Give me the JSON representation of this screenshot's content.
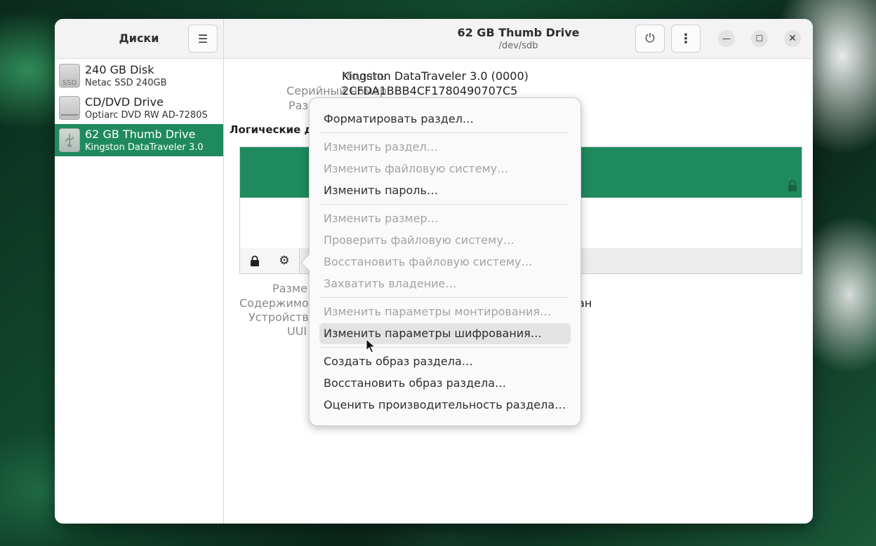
{
  "sidebar": {
    "title": "Диски",
    "drives": [
      {
        "name": "240 GB Disk",
        "model": "Netac SSD 240GB",
        "icon": "ssd-icon",
        "icon_text": "SSD"
      },
      {
        "name": "CD/DVD Drive",
        "model": "Optiarc DVD RW AD-7280S",
        "icon": "optical-drive-icon"
      },
      {
        "name": "62 GB Thumb Drive",
        "model": "Kingston DataTraveler 3.0",
        "icon": "usb-drive-icon",
        "selected": true
      }
    ]
  },
  "header": {
    "title": "62 GB Thumb Drive",
    "subtitle": "/dev/sdb"
  },
  "properties": {
    "model_label": "Модель",
    "model_value": "Kingston DataTraveler 3.0 (0000)",
    "serial_label": "Серийный номер",
    "serial_value": "2CFDA1BBB4CF1780490707C5",
    "partitioning_label_fragment": "Раз"
  },
  "volumes": {
    "section_title_fragment": "Логические д"
  },
  "details": {
    "size_label_fragment": "Разме",
    "contents_label_fragment": "Содержимо",
    "contents_value_fragment": "ан",
    "device_label_fragment": "Устройств",
    "uuid_label_fragment": "UUI"
  },
  "menu": {
    "items": [
      {
        "label": "Форматировать раздел…",
        "enabled": true
      },
      {
        "label": "Изменить раздел…",
        "enabled": false
      },
      {
        "label": "Изменить файловую систему…",
        "enabled": false
      },
      {
        "label": "Изменить пароль…",
        "enabled": true
      },
      {
        "label": "Изменить размер…",
        "enabled": false
      },
      {
        "label": "Проверить файловую систему…",
        "enabled": false
      },
      {
        "label": "Восстановить файловую систему…",
        "enabled": false
      },
      {
        "label": "Захватить владение…",
        "enabled": false
      },
      {
        "label": "Изменить параметры монтирования…",
        "enabled": false
      },
      {
        "label": "Изменить параметры шифрования…",
        "enabled": true,
        "hovered": true
      },
      {
        "label": "Создать образ раздела…",
        "enabled": true
      },
      {
        "label": "Восстановить образ раздела…",
        "enabled": true
      },
      {
        "label": "Оценить производительность раздела…",
        "enabled": true
      }
    ]
  },
  "colors": {
    "accent": "#1f8a5e",
    "disabled_text": "#a3a3a3"
  }
}
